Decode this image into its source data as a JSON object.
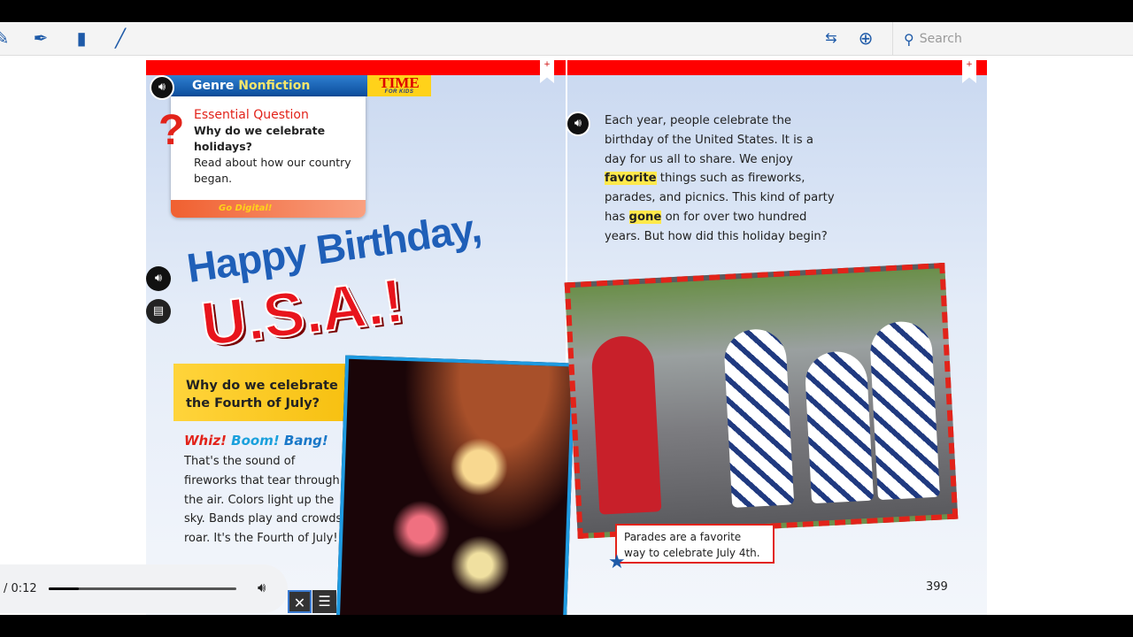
{
  "toolbar": {
    "icons": [
      "highlighter-icon",
      "pen-icon",
      "note-icon",
      "pencil-icon",
      "fit-width-icon",
      "zoom-in-icon"
    ],
    "search_placeholder": "Search"
  },
  "left_page": {
    "genre_label": "Genre",
    "genre_value": "Nonfiction",
    "brand": "TIME",
    "brand_sub": "FOR KIDS",
    "eq_title": "Essential Question",
    "eq_question": "Why do we celebrate holidays?",
    "eq_text": "Read about how our country began.",
    "go_digital": "Go Digital!",
    "title_line1": "Happy Birthday,",
    "title_line2": "U.S.A.!",
    "section_question": "Why do we celebrate the Fourth of July?",
    "whiz": "Whiz!",
    "boom": "Boom!",
    "bang": "Bang!",
    "body": "That's the sound of fireworks that tear through the air. Colors light up the sky. Bands play and crowds roar. It's the Fourth of July!"
  },
  "right_page": {
    "p1": "Each year, people celebrate the birthday of the United States. It is a day for us all to share. We enjoy",
    "hl1": "favorite",
    "p2": "things such as fireworks, parades, and picnics. This kind of party has",
    "hl2": "gone",
    "p3": "on for over two hundred years. But how did this holiday begin?",
    "caption": "Parades are a favorite way to celebrate July 4th.",
    "page_number": "399"
  },
  "player": {
    "time": "/ 0:12",
    "progress": 0.16
  },
  "controls": {
    "close": "✕",
    "menu": "☰"
  },
  "colors": {
    "accent": "#1e5aa8",
    "red": "#e2231a",
    "yellow": "#ffd43b"
  }
}
